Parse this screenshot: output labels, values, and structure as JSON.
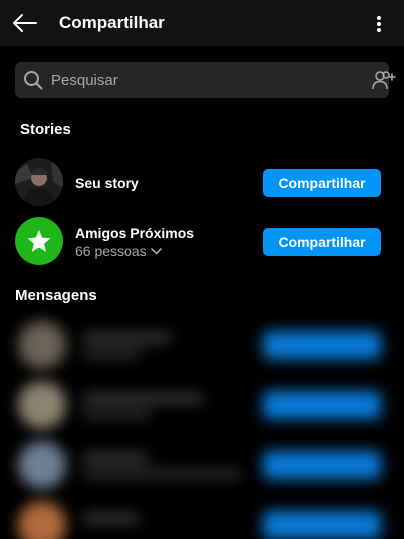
{
  "header": {
    "title": "Compartilhar",
    "back_icon": "arrow-left-icon",
    "more_icon": "kebab-menu-icon"
  },
  "search": {
    "placeholder": "Pesquisar",
    "icon": "search-icon",
    "add_people_icon": "add-people-icon"
  },
  "stories": {
    "section_title": "Stories",
    "items": [
      {
        "name": "Seu story",
        "button": "Compartilhar"
      },
      {
        "name": "Amigos Próximos",
        "subtitle": "66 pessoas",
        "button": "Compartilhar",
        "icon": "star-icon",
        "icon_bg": "#1fb61a"
      }
    ]
  },
  "messages": {
    "section_title": "Mensagens"
  },
  "colors": {
    "accent": "#0095f6",
    "background": "#000000",
    "header_bg": "#121212",
    "search_bg": "#262626"
  }
}
